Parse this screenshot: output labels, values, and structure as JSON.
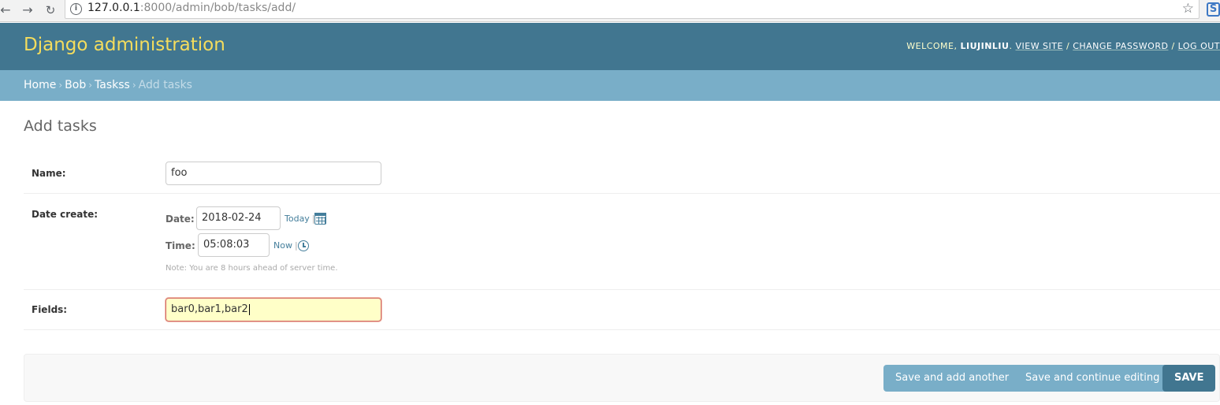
{
  "browser": {
    "url_host": "127.0.0.1",
    "url_rest": ":8000/admin/bob/tasks/add/"
  },
  "header": {
    "brand": "Django administration",
    "welcome": "WELCOME,",
    "username": "LIUJINLIU",
    "view_site": "VIEW SITE",
    "change_password": "CHANGE PASSWORD",
    "log_out": "LOG OUT"
  },
  "breadcrumbs": {
    "home": "Home",
    "app": "Bob",
    "model": "Taskss",
    "current": "Add tasks"
  },
  "page": {
    "title": "Add tasks"
  },
  "form": {
    "name": {
      "label": "Name:",
      "value": "foo"
    },
    "date_create": {
      "label": "Date create:",
      "date_label": "Date:",
      "date_value": "2018-02-24",
      "today": "Today",
      "time_label": "Time:",
      "time_value": "05:08:03",
      "now": "Now",
      "note": "Note: You are 8 hours ahead of server time."
    },
    "fields": {
      "label": "Fields:",
      "value": "bar0,bar1,bar2"
    }
  },
  "submit": {
    "save_add_another": "Save and add another",
    "save_continue": "Save and continue editing",
    "save": "SAVE"
  },
  "colors": {
    "header_bg": "#417690",
    "brand": "#f5dd5d",
    "breadcrumbs_bg": "#79aec8",
    "focus_bg": "#ffffc8"
  }
}
